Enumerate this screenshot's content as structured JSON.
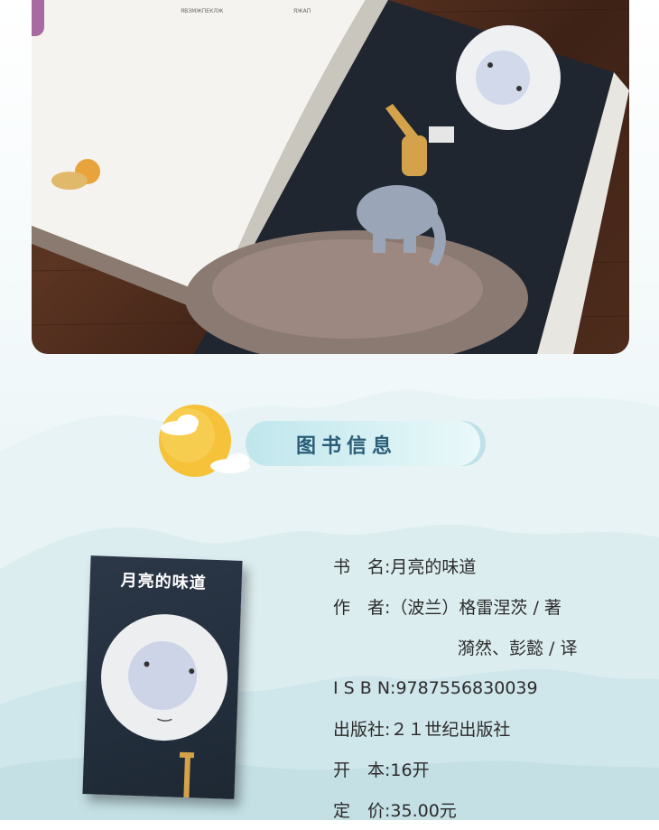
{
  "hero": {
    "page_small_text": "ЯВЗМЖПЕКЛЖ",
    "page_small_text_2": "ЯЖАП"
  },
  "section": {
    "title": "图书信息"
  },
  "cover": {
    "title": "月亮的味道"
  },
  "info": {
    "rows": [
      {
        "label": "书　名:",
        "value": "月亮的味道"
      },
      {
        "label": "作　者:",
        "value": "（波兰）格雷涅茨 / 著"
      },
      {
        "label": "",
        "value": "漪然、彭懿 / 译"
      },
      {
        "label": "I S B N:",
        "value": "9787556830039"
      },
      {
        "label": "出版社:",
        "value": "２１世纪出版社"
      },
      {
        "label": "开　本:",
        "value": "16开"
      },
      {
        "label": "定　价:",
        "value": "35.00元"
      }
    ]
  },
  "colors": {
    "title_color": "#2a5d78",
    "moon_yellow": "#f5c23a",
    "pill_blue": "#c7eaef"
  }
}
